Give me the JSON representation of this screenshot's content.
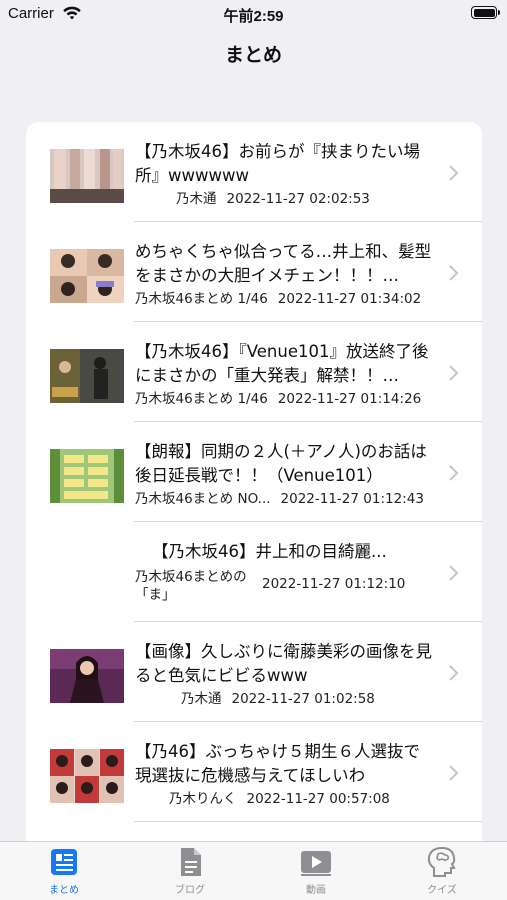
{
  "status": {
    "carrier": "Carrier",
    "time": "午前2:59"
  },
  "nav": {
    "title": "まとめ"
  },
  "articles": [
    {
      "title": "【乃木坂46】お前らが『挟まりたい場所』wwwwww",
      "source": "乃木通",
      "date": "2022-11-27 02:02:53",
      "thumb": "legs"
    },
    {
      "title": "めちゃくちゃ似合ってる…井上和、髪型をまさかの大胆イメチェン！！！…",
      "source": "乃木坂46まとめ 1/46",
      "date": "2022-11-27 01:34:02",
      "thumb": "girls"
    },
    {
      "title": "【乃木坂46】『Venue101』放送終了後にまさかの「重大発表」解禁！！…",
      "source": "乃木坂46まとめ 1/46",
      "date": "2022-11-27 01:14:26",
      "thumb": "stage"
    },
    {
      "title": "【朗報】同期の２人(＋アノ人)のお話は後日延長戦で！！（Venue101）",
      "source": "乃木坂46まとめ NO...",
      "date": "2022-11-27 01:12:43",
      "thumb": "green"
    },
    {
      "title": "【乃木坂46】井上和の目綺麗...",
      "source": "乃木坂46まとめの「ま」",
      "date": "2022-11-27 01:12:10",
      "thumb": "none"
    },
    {
      "title": "【画像】久しぶりに衛藤美彩の画像を見ると色気にビビるwww",
      "source": "乃木通",
      "date": "2022-11-27 01:02:58",
      "thumb": "portrait"
    },
    {
      "title": "【乃46】ぶっちゃけ５期生６人選抜で現選抜に危機感与えてほしいわ",
      "source": "乃木りんく",
      "date": "2022-11-27 00:57:08",
      "thumb": "grid"
    }
  ],
  "tabs": [
    {
      "label": "まとめ",
      "icon": "newspaper-icon",
      "active": true
    },
    {
      "label": "ブログ",
      "icon": "document-icon",
      "active": false
    },
    {
      "label": "動画",
      "icon": "video-icon",
      "active": false
    },
    {
      "label": "クイズ",
      "icon": "brain-icon",
      "active": false
    }
  ],
  "colors": {
    "accent": "#1877f2",
    "inactive": "#8e8e93",
    "background": "#efeff4"
  }
}
